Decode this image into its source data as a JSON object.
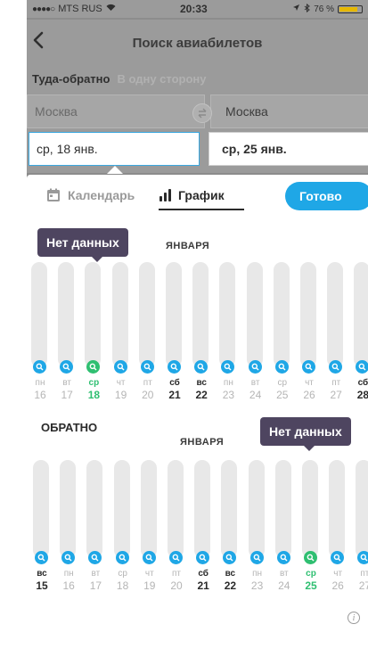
{
  "status_bar": {
    "carrier": "MTS RUS",
    "time": "20:33",
    "battery": "76 %",
    "battery_level": 0.76
  },
  "navbar": {
    "title": "Поиск авиабилетов"
  },
  "trip_type": {
    "round_trip": "Туда-обратно",
    "one_way": "В одну сторону"
  },
  "cities": {
    "from": "Москва",
    "to": "Москва"
  },
  "dates": {
    "outbound": "ср, 18 янв.",
    "return": "ср, 25 янв."
  },
  "tabs": {
    "calendar": "Календарь",
    "chart": "График",
    "done": "Готово"
  },
  "outbound_section": {
    "month": "ЯНВАРЯ",
    "tooltip": "Нет данных",
    "days": [
      {
        "wd": "пн",
        "dn": "16"
      },
      {
        "wd": "вт",
        "dn": "17"
      },
      {
        "wd": "ср",
        "dn": "18",
        "selected": true
      },
      {
        "wd": "чт",
        "dn": "19"
      },
      {
        "wd": "пт",
        "dn": "20"
      },
      {
        "wd": "сб",
        "dn": "21",
        "weekend": true
      },
      {
        "wd": "вс",
        "dn": "22",
        "weekend": true
      },
      {
        "wd": "пн",
        "dn": "23"
      },
      {
        "wd": "вт",
        "dn": "24"
      },
      {
        "wd": "ср",
        "dn": "25"
      },
      {
        "wd": "чт",
        "dn": "26"
      },
      {
        "wd": "пт",
        "dn": "27"
      },
      {
        "wd": "сб",
        "dn": "28",
        "weekend": true
      }
    ]
  },
  "return_section": {
    "title": "ОБРАТНО",
    "month": "ЯНВАРЯ",
    "tooltip": "Нет данных",
    "days": [
      {
        "wd": "вс",
        "dn": "15",
        "weekend": true
      },
      {
        "wd": "пн",
        "dn": "16"
      },
      {
        "wd": "вт",
        "dn": "17"
      },
      {
        "wd": "ср",
        "dn": "18"
      },
      {
        "wd": "чт",
        "dn": "19"
      },
      {
        "wd": "пт",
        "dn": "20"
      },
      {
        "wd": "сб",
        "dn": "21",
        "weekend": true
      },
      {
        "wd": "вс",
        "dn": "22",
        "weekend": true
      },
      {
        "wd": "пн",
        "dn": "23"
      },
      {
        "wd": "вт",
        "dn": "24"
      },
      {
        "wd": "ср",
        "dn": "25",
        "selected": true
      },
      {
        "wd": "чт",
        "dn": "26"
      },
      {
        "wd": "пт",
        "dn": "27"
      }
    ]
  },
  "colors": {
    "accent": "#1fa7e6",
    "selected": "#2fbf71",
    "tooltip": "#4e4560"
  }
}
